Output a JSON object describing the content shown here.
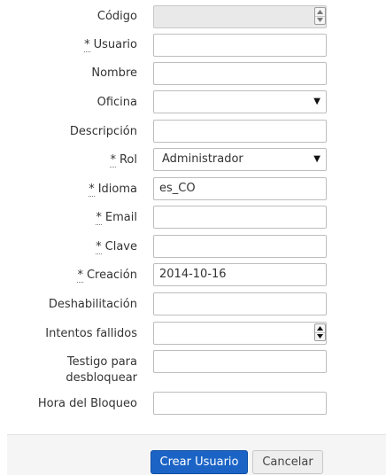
{
  "form": {
    "fields": [
      {
        "label": "Código",
        "required": false,
        "value": "",
        "type": "number",
        "disabled": true
      },
      {
        "label": "Usuario",
        "required": true,
        "value": "",
        "type": "text"
      },
      {
        "label": "Nombre",
        "required": false,
        "value": "",
        "type": "text"
      },
      {
        "label": "Oficina",
        "required": false,
        "value": "",
        "type": "select"
      },
      {
        "label": "Descripción",
        "required": false,
        "value": "",
        "type": "text"
      },
      {
        "label": "Rol",
        "required": true,
        "value": "Administrador",
        "type": "select"
      },
      {
        "label": "Idioma",
        "required": true,
        "value": "es_CO",
        "type": "text"
      },
      {
        "label": "Email",
        "required": true,
        "value": "",
        "type": "text"
      },
      {
        "label": "Clave",
        "required": true,
        "value": "",
        "type": "password"
      },
      {
        "label": "Creación",
        "required": true,
        "value": "2014-10-16",
        "type": "date"
      },
      {
        "label": "Deshabilitación",
        "required": false,
        "value": "",
        "type": "date"
      },
      {
        "label": "Intentos fallidos",
        "required": false,
        "value": "",
        "type": "number"
      },
      {
        "label_line1": "Testigo para",
        "label_line2": "desbloquear",
        "required": false,
        "value": "",
        "type": "text"
      },
      {
        "label": "Hora del Bloqueo",
        "required": false,
        "value": "",
        "type": "text"
      }
    ],
    "required_marker": "*"
  },
  "footer": {
    "submit_label": "Crear Usuario",
    "cancel_label": "Cancelar"
  },
  "icons": {
    "select_caret": "triangle-down-icon",
    "spinner_up": "spin-up-icon",
    "spinner_down": "spin-down-icon"
  }
}
